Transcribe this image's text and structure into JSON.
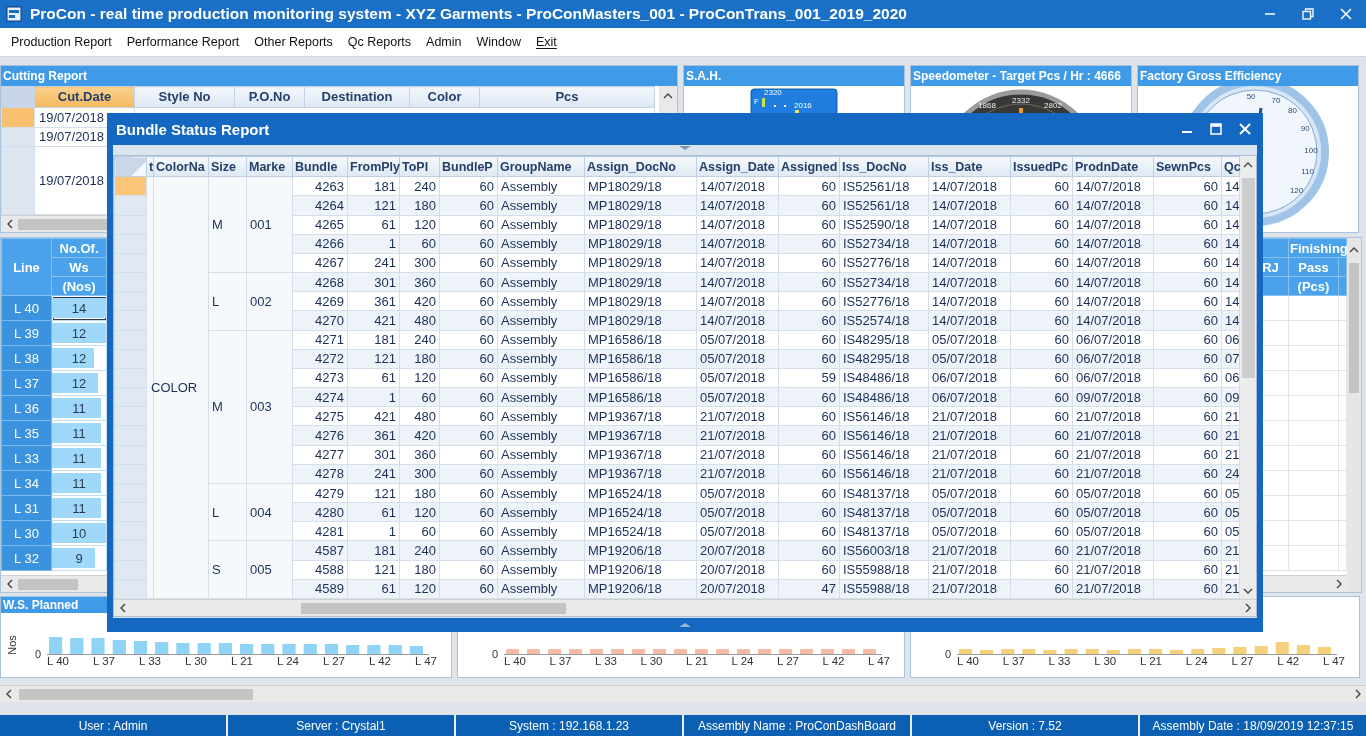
{
  "window": {
    "title": "ProCon - real time production monitoring system - XYZ Garments - ProConMasters_001 - ProConTrans_001_2019_2020"
  },
  "menu": [
    {
      "label": "Production Report"
    },
    {
      "label": "Performance Report"
    },
    {
      "label": "Other Reports"
    },
    {
      "label": "Qc Reports"
    },
    {
      "label": "Admin"
    },
    {
      "label": "Window"
    },
    {
      "label": "Exit"
    }
  ],
  "cutting_report": {
    "title": "Cutting Report",
    "columns": [
      {
        "label": "Cut.Date",
        "selected": true
      },
      {
        "label": "Style No",
        "selected": false
      },
      {
        "label": "P.O.No",
        "selected": false
      },
      {
        "label": "Destination",
        "selected": false
      },
      {
        "label": "Color",
        "selected": false
      },
      {
        "label": "Pcs",
        "selected": false
      }
    ],
    "rows": [
      {
        "cut_date": "19/07/2018",
        "selected": true
      },
      {
        "cut_date": "19/07/2018",
        "selected": false
      },
      {
        "cut_date": "19/07/2018",
        "selected": false
      }
    ]
  },
  "gauges": [
    {
      "kind": "digital",
      "title": "S.A.H.",
      "labels": [
        "2320",
        "F",
        "2016"
      ]
    },
    {
      "kind": "dial-dark",
      "title": "Speedometer - Target Pcs / Hr : 4666",
      "labels": [
        "1868",
        "2332",
        "2802"
      ]
    },
    {
      "kind": "dial-light",
      "title": "Factory Gross Efficiency",
      "labels": [
        "50",
        "70",
        "80",
        "90",
        "100",
        "110",
        "120"
      ]
    }
  ],
  "line_panel": {
    "line_header": "Line",
    "ws_header": [
      "No.Of.",
      "Ws",
      "(Nos)"
    ],
    "group_header": "Finishing",
    "rj_header": "RJ",
    "pass_header": [
      "Pass",
      "(Pcs)"
    ],
    "rows": [
      {
        "line": "L 40",
        "ws": "14",
        "level": 1,
        "selected": true
      },
      {
        "line": "L 39",
        "ws": "12",
        "level": 1,
        "selected": false
      },
      {
        "line": "L 38",
        "ws": "12",
        "level": 0.78,
        "selected": false
      },
      {
        "line": "L 37",
        "ws": "12",
        "level": 0.85,
        "selected": false
      },
      {
        "line": "L 36",
        "ws": "11",
        "level": 0.9,
        "selected": false
      },
      {
        "line": "L 35",
        "ws": "11",
        "level": 0.9,
        "selected": false
      },
      {
        "line": "L 33",
        "ws": "11",
        "level": 0.9,
        "selected": false
      },
      {
        "line": "L 34",
        "ws": "11",
        "level": 0.9,
        "selected": false
      },
      {
        "line": "L 31",
        "ws": "11",
        "level": 0.9,
        "selected": false
      },
      {
        "line": "L 30",
        "ws": "10",
        "level": 1,
        "selected": false
      },
      {
        "line": "L 32",
        "ws": "9",
        "level": 0.8,
        "selected": false
      }
    ]
  },
  "charts": [
    {
      "title": "W.S. Planned",
      "ylabel": "Nos",
      "ytick": "0",
      "color": "#8fd3f7",
      "xlabels": [
        "L 40",
        "L 37",
        "L 33",
        "L 30",
        "L 21",
        "L 24",
        "L 27",
        "L 42",
        "L 47"
      ]
    },
    {
      "ytick": "0",
      "color": "#f8bba5",
      "xlabels": [
        "L 40",
        "L 37",
        "L 33",
        "L 30",
        "L 21",
        "L 24",
        "L 27",
        "L 42",
        "L 47"
      ]
    },
    {
      "ytick": "0",
      "color": "#f5d17c",
      "xlabels": [
        "L 40",
        "L 37",
        "L 33",
        "L 30",
        "L 21",
        "L 24",
        "L 27",
        "L 42",
        "L 47"
      ]
    }
  ],
  "status_bar": [
    "User : Admin",
    "Server : Crystal1",
    "System : 192.168.1.23",
    "Assembly Name : ProConDashBoard",
    "Version : 7.52",
    "Assembly Date : 18/09/2019 12:37:15"
  ],
  "bundle_window": {
    "title": "Bundle Status Report",
    "columns": [
      "t",
      "ColorNa",
      "Size",
      "Marke",
      "Bundle",
      "FromPly",
      "ToPl",
      "BundleP",
      "GroupName",
      "Assign_DocNo",
      "Assign_Date",
      "Assigned",
      "Iss_DocNo",
      "Iss_Date",
      "IssuedPc",
      "ProdnDate",
      "SewnPcs",
      "Qc"
    ],
    "color_name": "COLOR",
    "groups": [
      {
        "size": "M",
        "marker": "001",
        "rows": [
          {
            "selected": true,
            "cells": [
              "4263",
              "181",
              "240",
              "60",
              "Assembly",
              "MP18029/18",
              "14/07/2018",
              "60",
              "IS52561/18",
              "14/07/2018",
              "60",
              "14/07/2018",
              "60",
              "14"
            ]
          },
          {
            "selected": false,
            "cells": [
              "4264",
              "121",
              "180",
              "60",
              "Assembly",
              "MP18029/18",
              "14/07/2018",
              "60",
              "IS52561/18",
              "14/07/2018",
              "60",
              "14/07/2018",
              "60",
              "14"
            ]
          },
          {
            "selected": false,
            "cells": [
              "4265",
              "61",
              "120",
              "60",
              "Assembly",
              "MP18029/18",
              "14/07/2018",
              "60",
              "IS52590/18",
              "14/07/2018",
              "60",
              "14/07/2018",
              "60",
              "14"
            ]
          },
          {
            "selected": false,
            "cells": [
              "4266",
              "1",
              "60",
              "60",
              "Assembly",
              "MP18029/18",
              "14/07/2018",
              "60",
              "IS52734/18",
              "14/07/2018",
              "60",
              "14/07/2018",
              "60",
              "14"
            ]
          },
          {
            "selected": false,
            "cells": [
              "4267",
              "241",
              "300",
              "60",
              "Assembly",
              "MP18029/18",
              "14/07/2018",
              "60",
              "IS52776/18",
              "14/07/2018",
              "60",
              "14/07/2018",
              "60",
              "14"
            ]
          }
        ]
      },
      {
        "size": "L",
        "marker": "002",
        "rows": [
          {
            "selected": false,
            "cells": [
              "4268",
              "301",
              "360",
              "60",
              "Assembly",
              "MP18029/18",
              "14/07/2018",
              "60",
              "IS52734/18",
              "14/07/2018",
              "60",
              "14/07/2018",
              "60",
              "14"
            ]
          },
          {
            "selected": false,
            "cells": [
              "4269",
              "361",
              "420",
              "60",
              "Assembly",
              "MP18029/18",
              "14/07/2018",
              "60",
              "IS52776/18",
              "14/07/2018",
              "60",
              "14/07/2018",
              "60",
              "14"
            ]
          },
          {
            "selected": false,
            "cells": [
              "4270",
              "421",
              "480",
              "60",
              "Assembly",
              "MP18029/18",
              "14/07/2018",
              "60",
              "IS52574/18",
              "14/07/2018",
              "60",
              "14/07/2018",
              "60",
              "14"
            ]
          }
        ]
      },
      {
        "size": "M",
        "marker": "003",
        "rows": [
          {
            "selected": false,
            "cells": [
              "4271",
              "181",
              "240",
              "60",
              "Assembly",
              "MP16586/18",
              "05/07/2018",
              "60",
              "IS48295/18",
              "05/07/2018",
              "60",
              "06/07/2018",
              "60",
              "06"
            ]
          },
          {
            "selected": false,
            "cells": [
              "4272",
              "121",
              "180",
              "60",
              "Assembly",
              "MP16586/18",
              "05/07/2018",
              "60",
              "IS48295/18",
              "05/07/2018",
              "60",
              "06/07/2018",
              "60",
              "07"
            ]
          },
          {
            "selected": false,
            "cells": [
              "4273",
              "61",
              "120",
              "60",
              "Assembly",
              "MP16586/18",
              "05/07/2018",
              "59",
              "IS48486/18",
              "06/07/2018",
              "60",
              "06/07/2018",
              "60",
              "06"
            ]
          },
          {
            "selected": false,
            "cells": [
              "4274",
              "1",
              "60",
              "60",
              "Assembly",
              "MP16586/18",
              "05/07/2018",
              "60",
              "IS48486/18",
              "06/07/2018",
              "60",
              "09/07/2018",
              "60",
              "09"
            ]
          },
          {
            "selected": false,
            "cells": [
              "4275",
              "421",
              "480",
              "60",
              "Assembly",
              "MP19367/18",
              "21/07/2018",
              "60",
              "IS56146/18",
              "21/07/2018",
              "60",
              "21/07/2018",
              "60",
              "21"
            ]
          },
          {
            "selected": false,
            "cells": [
              "4276",
              "361",
              "420",
              "60",
              "Assembly",
              "MP19367/18",
              "21/07/2018",
              "60",
              "IS56146/18",
              "21/07/2018",
              "60",
              "21/07/2018",
              "60",
              "21"
            ]
          },
          {
            "selected": false,
            "cells": [
              "4277",
              "301",
              "360",
              "60",
              "Assembly",
              "MP19367/18",
              "21/07/2018",
              "60",
              "IS56146/18",
              "21/07/2018",
              "60",
              "21/07/2018",
              "60",
              "21"
            ]
          },
          {
            "selected": false,
            "cells": [
              "4278",
              "241",
              "300",
              "60",
              "Assembly",
              "MP19367/18",
              "21/07/2018",
              "60",
              "IS56146/18",
              "21/07/2018",
              "60",
              "21/07/2018",
              "60",
              "24"
            ]
          }
        ]
      },
      {
        "size": "L",
        "marker": "004",
        "rows": [
          {
            "selected": false,
            "cells": [
              "4279",
              "121",
              "180",
              "60",
              "Assembly",
              "MP16524/18",
              "05/07/2018",
              "60",
              "IS48137/18",
              "05/07/2018",
              "60",
              "05/07/2018",
              "60",
              "05"
            ]
          },
          {
            "selected": false,
            "cells": [
              "4280",
              "61",
              "120",
              "60",
              "Assembly",
              "MP16524/18",
              "05/07/2018",
              "60",
              "IS48137/18",
              "05/07/2018",
              "60",
              "05/07/2018",
              "60",
              "05"
            ]
          },
          {
            "selected": false,
            "cells": [
              "4281",
              "1",
              "60",
              "60",
              "Assembly",
              "MP16524/18",
              "05/07/2018",
              "60",
              "IS48137/18",
              "05/07/2018",
              "60",
              "05/07/2018",
              "60",
              "05"
            ]
          }
        ]
      },
      {
        "size": "S",
        "marker": "005",
        "rows": [
          {
            "selected": false,
            "cells": [
              "4587",
              "181",
              "240",
              "60",
              "Assembly",
              "MP19206/18",
              "20/07/2018",
              "60",
              "IS56003/18",
              "21/07/2018",
              "60",
              "21/07/2018",
              "60",
              "21"
            ]
          },
          {
            "selected": false,
            "cells": [
              "4588",
              "121",
              "180",
              "60",
              "Assembly",
              "MP19206/18",
              "20/07/2018",
              "60",
              "IS55988/18",
              "21/07/2018",
              "60",
              "21/07/2018",
              "60",
              "21"
            ]
          },
          {
            "selected": false,
            "cells": [
              "4589",
              "61",
              "120",
              "60",
              "Assembly",
              "MP19206/18",
              "20/07/2018",
              "47",
              "IS55988/18",
              "21/07/2018",
              "60",
              "21/07/2018",
              "60",
              "21"
            ]
          }
        ]
      }
    ]
  }
}
